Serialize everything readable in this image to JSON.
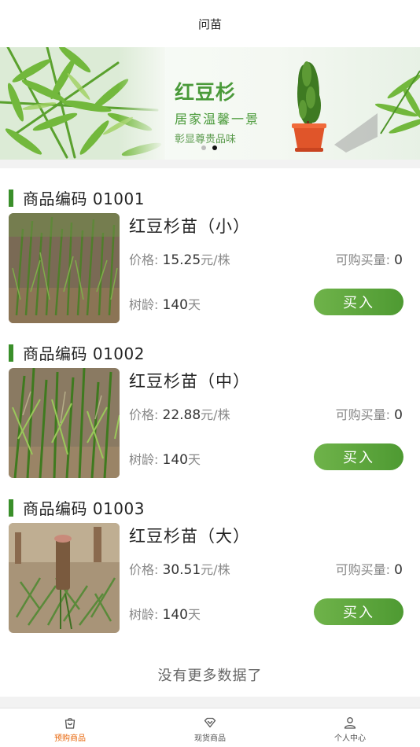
{
  "header": {
    "title": "问苗"
  },
  "banner": {
    "title": "红豆杉",
    "line1": "居家温馨一景",
    "line2": "彰显尊贵品味",
    "slides": 2,
    "active_slide": 2
  },
  "products": [
    {
      "code_label": "商品编码 01001",
      "name": "红豆杉苗（小）",
      "price_label": "价格:",
      "price": "15.25",
      "price_unit": "元/株",
      "qty_label": "可购买量:",
      "qty": "0",
      "age_label": "树龄:",
      "age": "140",
      "age_unit": "天",
      "buy_label": "买入"
    },
    {
      "code_label": "商品编码 01002",
      "name": "红豆杉苗（中）",
      "price_label": "价格:",
      "price": "22.88",
      "price_unit": "元/株",
      "qty_label": "可购买量:",
      "qty": "0",
      "age_label": "树龄:",
      "age": "140",
      "age_unit": "天",
      "buy_label": "买入"
    },
    {
      "code_label": "商品编码 01003",
      "name": "红豆杉苗（大）",
      "price_label": "价格:",
      "price": "30.51",
      "price_unit": "元/株",
      "qty_label": "可购买量:",
      "qty": "0",
      "age_label": "树龄:",
      "age": "140",
      "age_unit": "天",
      "buy_label": "买入"
    }
  ],
  "footer_text": "没有更多数据了",
  "tabbar": {
    "tabs": [
      {
        "label": "预购商品",
        "icon": "shopping-bag-icon",
        "active": true
      },
      {
        "label": "现货商品",
        "icon": "diamond-icon",
        "active": false
      },
      {
        "label": "个人中心",
        "icon": "user-icon",
        "active": false
      }
    ]
  },
  "colors": {
    "accent_green": "#4e9a32",
    "active_tab": "#e8660a",
    "code_bar": "#3a8f2a"
  }
}
